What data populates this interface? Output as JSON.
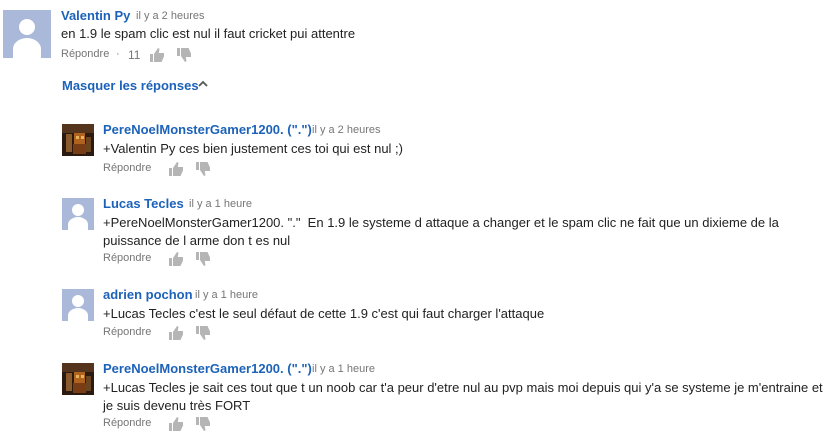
{
  "comment": {
    "author": "Valentin Py",
    "time": "il y a 2 heures",
    "text": "en 1.9 le spam clic est nul il faut cricket pui attentre",
    "reply_label": "Répondre",
    "separator": "·",
    "like_count": "11"
  },
  "hide_replies": {
    "label": "Masquer les réponses",
    "icon": "chevron-up-icon"
  },
  "replies": [
    {
      "author": "PereNoelMonsterGamer1200. (\".\")",
      "time": "il y a 2 heures",
      "text": "+Valentin Py ces bien justement ces toi qui est nul ;)",
      "reply_label": "Répondre",
      "avatar": "game"
    },
    {
      "author": "Lucas Tecles",
      "time": "il y a 1 heure",
      "text_line1": "+PereNoelMonsterGamer1200. \".\"  En 1.9 le systeme d attaque a changer et le spam clic ne fait que un dixieme de la",
      "text_line2": "puissance de l arme don t es nul",
      "reply_label": "Répondre",
      "avatar": "default"
    },
    {
      "author": "adrien pochon",
      "time": "il y a 1 heure",
      "text": "+Lucas Tecles c'est le seul défaut de cette 1.9 c'est qui faut charger l'attaque",
      "reply_label": "Répondre",
      "avatar": "default"
    },
    {
      "author": "PereNoelMonsterGamer1200. (\".\")",
      "time": "il y a 1 heure",
      "text_line1": "+Lucas Tecles je sait ces tout que t un noob car t'a peur d'etre nul au pvp mais moi depuis qui y'a se systeme je m'entraine et",
      "text_line2": "je suis devenu très FORT",
      "reply_label": "Répondre",
      "avatar": "game"
    }
  ],
  "colors": {
    "link": "#1c62b9",
    "meta": "#767676",
    "text": "#222222",
    "avatar_bg": "#aab9d9"
  }
}
